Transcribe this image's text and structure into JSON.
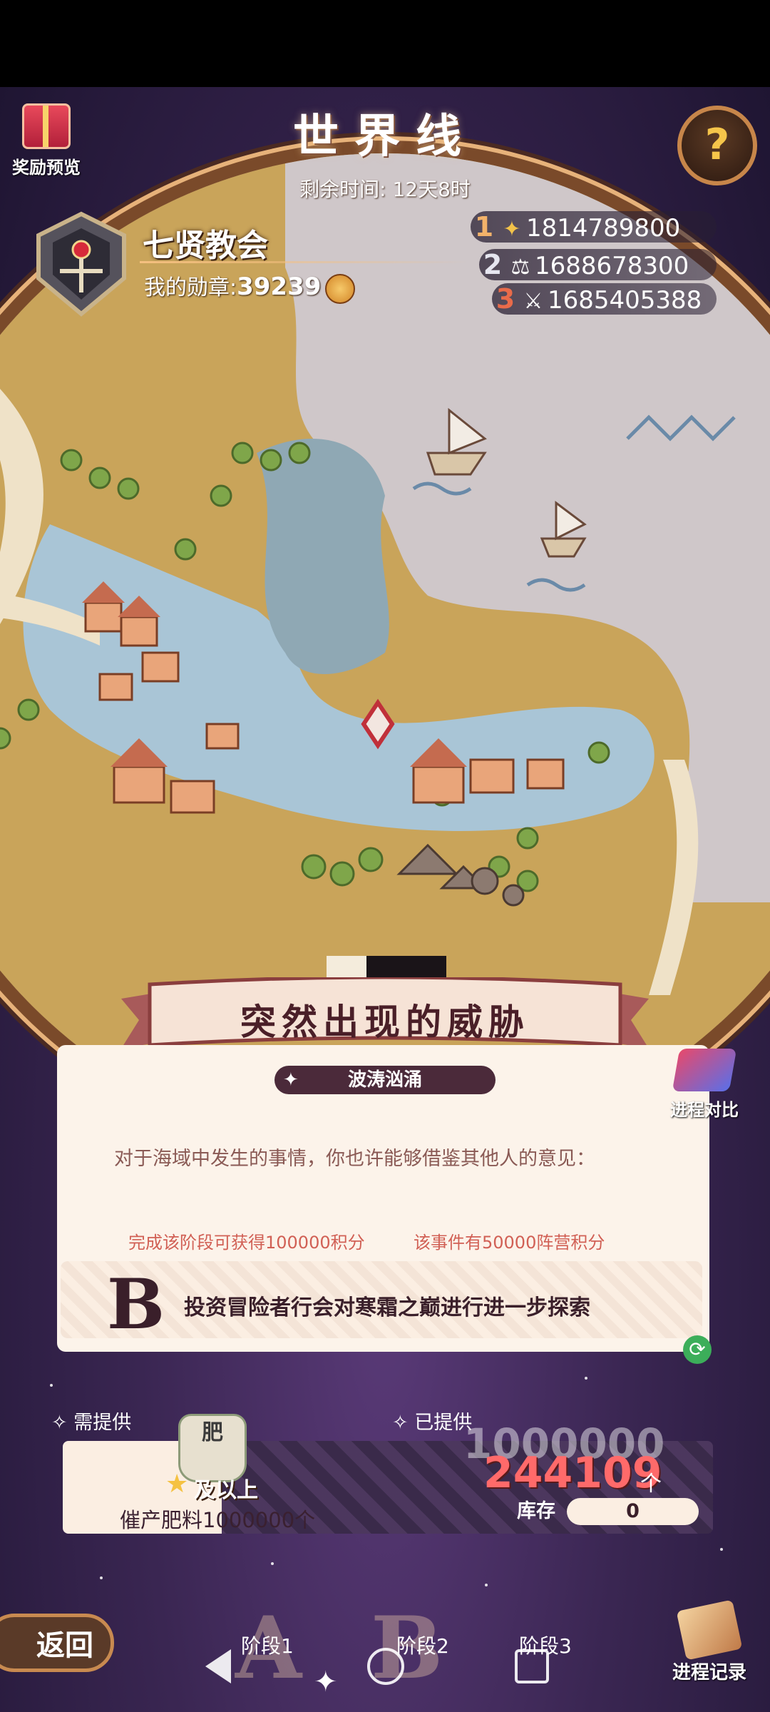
{
  "header": {
    "title": "世界线",
    "remaining_time": "剩余时间: 12天8时",
    "reward_preview_label": "奖励预览",
    "help_label": "?"
  },
  "guild": {
    "name": "七贤教会",
    "medal_label": "我的勋章:",
    "medal_value": "39239"
  },
  "rankings": [
    {
      "rank": "1",
      "score": "1814789800",
      "icon": "wing-emblem-icon"
    },
    {
      "rank": "2",
      "score": "1688678300",
      "icon": "scale-emblem-icon"
    },
    {
      "rank": "3",
      "score": "1685405388",
      "icon": "sword-emblem-icon"
    }
  ],
  "event": {
    "title": "突然出现的威胁",
    "stage_name": "波涛汹涌",
    "description": "对于海域中发生的事情，你也许能够借鉴其他人的意见：",
    "stage_reward_note": "完成该阶段可获得100000积分",
    "faction_reward_note": "该事件有50000阵营积分",
    "choice_letter": "B",
    "choice_text": "投资冒险者行会对寒霜之巅进行进一步探索",
    "progress_compare_label": "进程对比"
  },
  "supply": {
    "need_label": "需提供",
    "provided_label": "已提供",
    "item_glyph": "肥",
    "tier_label": "及以上",
    "requirement": "催产肥料1000000个",
    "target_value": "1000000",
    "current_value": "244109",
    "unit": "个",
    "stock_label": "库存",
    "stock_value": "0",
    "progress_fraction": 0.244
  },
  "footer": {
    "back_label": "返回",
    "stage_tabs": [
      "阶段1",
      "阶段2",
      "阶段3"
    ],
    "record_label": "进程记录"
  },
  "colors": {
    "accent_red": "#ff6a6a",
    "frame_gold": "#e7b27a",
    "panel_bg": "#fcf3ea",
    "deep_purple": "#3a2652"
  }
}
